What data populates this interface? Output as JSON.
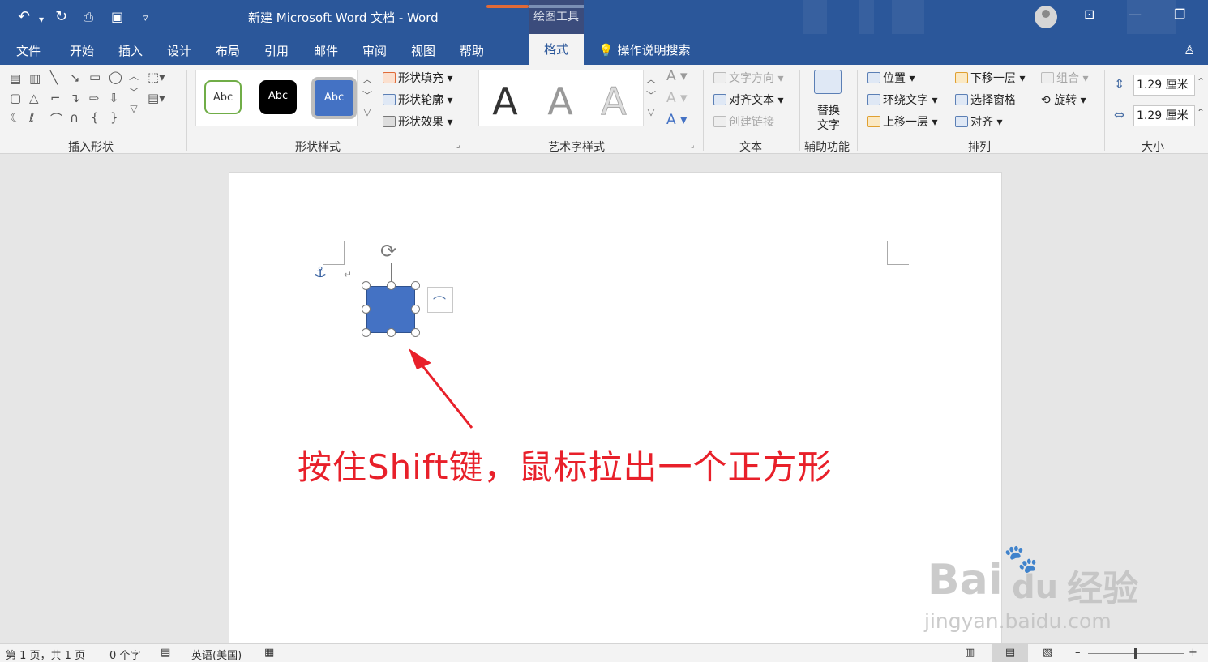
{
  "title_bar": {
    "document_title": "新建 Microsoft Word 文档  -  Word",
    "contextual_tab_group": "绘图工具",
    "quick_access": [
      {
        "name": "undo-icon",
        "glyph": "↶"
      },
      {
        "name": "undo-dropdown-icon",
        "glyph": "▾"
      },
      {
        "name": "redo-icon",
        "glyph": "↻"
      },
      {
        "name": "print-preview-icon",
        "glyph": "🔍"
      },
      {
        "name": "save-icon",
        "glyph": "💾"
      },
      {
        "name": "customize-qat-icon",
        "glyph": "▿"
      }
    ],
    "window_buttons": [
      {
        "name": "ribbon-display-icon",
        "glyph": "⊡"
      },
      {
        "name": "minimize-icon",
        "glyph": "—"
      },
      {
        "name": "restore-icon",
        "glyph": "❐"
      }
    ]
  },
  "tabs": [
    {
      "label": "文件"
    },
    {
      "label": "开始"
    },
    {
      "label": "插入"
    },
    {
      "label": "设计"
    },
    {
      "label": "布局"
    },
    {
      "label": "引用"
    },
    {
      "label": "邮件"
    },
    {
      "label": "审阅"
    },
    {
      "label": "视图"
    },
    {
      "label": "帮助"
    }
  ],
  "active_tab": "格式",
  "tell_me": "操作说明搜索",
  "ribbon": {
    "groups": {
      "insert_shapes": "插入形状",
      "shape_styles": "形状样式",
      "wordart_styles": "艺术字样式",
      "text": "文本",
      "accessibility": "辅助功能",
      "arrange": "排列",
      "size": "大小"
    },
    "shape_styles": {
      "presets": [
        "Abc",
        "Abc",
        "Abc"
      ],
      "fill": "形状填充",
      "outline": "形状轮廓",
      "effects": "形状效果"
    },
    "wordart": {
      "presets": [
        "A",
        "A",
        "A"
      ]
    },
    "text": {
      "direction": "文字方向",
      "align": "对齐文本",
      "link": "创建链接"
    },
    "alt_text": [
      "替换",
      "文字"
    ],
    "arrange": {
      "position": "位置",
      "wrap": "环绕文字",
      "forward": "上移一层",
      "backward": "下移一层",
      "selection_pane": "选择窗格",
      "align": "对齐",
      "group": "组合",
      "rotate": "旋转"
    },
    "size": {
      "height": "1.29 厘米",
      "width": "1.29 厘米"
    }
  },
  "document": {
    "annotation": "按住Shift键，鼠标拉出一个正方形",
    "shape_color": "#4472c4"
  },
  "status_bar": {
    "page": "第 1 页，共 1 页",
    "words": "0 个字",
    "language": "英语(美国)",
    "zoom_level_fraction": 0.5
  },
  "watermark": {
    "brand": "Bai",
    "brand2": "du",
    "cn": "经验",
    "url": "jingyan.baidu.com"
  },
  "colors": {
    "accent": "#2b579a",
    "annotation": "#e8202a"
  }
}
